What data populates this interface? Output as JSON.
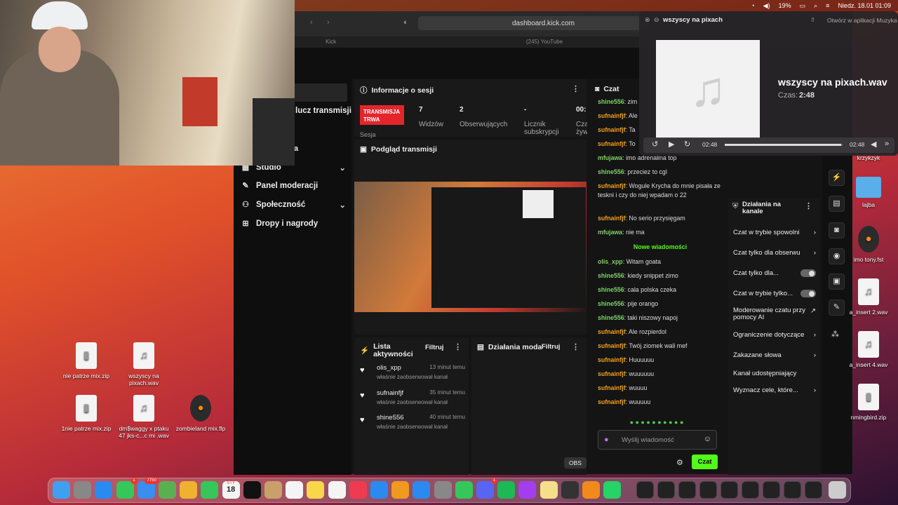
{
  "menubar": {
    "battery": "19%",
    "datetime": "Niedz. 18.01  01:09"
  },
  "browser": {
    "url": "dashboard.kick.com",
    "tab1": "Kick",
    "tab2": "(245) YouTube"
  },
  "leftnav": {
    "partial_label": "lucz transmisji",
    "partial_a": "a",
    "items": [
      {
        "label": "Studio",
        "icon": "studio-icon",
        "expand": true
      },
      {
        "label": "Panel moderacji",
        "icon": "wrench-icon",
        "expand": false
      },
      {
        "label": "Społeczność",
        "icon": "community-icon",
        "expand": true
      },
      {
        "label": "Dropy i nagrody",
        "icon": "gift-icon",
        "expand": false
      }
    ]
  },
  "session": {
    "title": "Informacje o sesji",
    "badge": "TRANSMISJA TRWA",
    "badge_sub": "Sesja",
    "stats": [
      {
        "value": "7",
        "label": "Widzów"
      },
      {
        "value": "2",
        "label": "Obserwujących"
      },
      {
        "value": "-",
        "label": "Licznik subskrypcji"
      },
      {
        "value": "00:",
        "label": "Cza żyw"
      }
    ]
  },
  "preview": {
    "title": "Podgląd transmisji"
  },
  "activity": {
    "title": "Lista aktywności",
    "filter": "Filtruj",
    "items": [
      {
        "user": "olis_xpp",
        "time": "13 minut temu",
        "action": "właśnie zaobserwował kanał"
      },
      {
        "user": "sufnainfjf",
        "time": "35 minut temu",
        "action": "właśnie zaobserwował kanał"
      },
      {
        "user": "shine556",
        "time": "40 minut temu",
        "action": "właśnie zaobserwował kanał"
      }
    ]
  },
  "modactions": {
    "title": "Działania moda",
    "filter": "Filtruj"
  },
  "chat": {
    "title": "Czat",
    "new_messages": "Nowe wiadomości",
    "placeholder": "Wyślij wiadomość",
    "send": "Czat",
    "messages": [
      {
        "user": "shine556",
        "text": "zim",
        "color": "green"
      },
      {
        "user": "sufnainfjf",
        "text": "Ale",
        "color": "orange"
      },
      {
        "user": "sufnainfjf",
        "text": "Ta",
        "color": "orange"
      },
      {
        "user": "sufnainfjf",
        "text": "To",
        "color": "orange"
      },
      {
        "user": "mfujawa",
        "text": "imo adrenalina top",
        "color": "green"
      },
      {
        "user": "shine556",
        "text": "przeciez to cgl",
        "color": "green"
      },
      {
        "user": "sufnainfjf",
        "text": "Wogule Krycha do mnie pisała ze teskni i czy do niej wpadam o 22",
        "color": "orange"
      },
      {
        "user": "sufnainfjf",
        "text": "No serio przysięgam",
        "color": "orange"
      },
      {
        "user": "mfujawa",
        "text": "nie ma",
        "color": "green"
      }
    ],
    "new": [
      {
        "user": "olis_xpp",
        "text": "Witam goata",
        "color": "green"
      },
      {
        "user": "shine556",
        "text": "kiedy snippet zimo",
        "color": "green"
      },
      {
        "user": "shine556",
        "text": "cala polska czeka",
        "color": "green"
      },
      {
        "user": "shine556",
        "text": "pije orango",
        "color": "green"
      },
      {
        "user": "shine556",
        "text": "taki niszowy napoj",
        "color": "green"
      },
      {
        "user": "sufnainfjf",
        "text": "Ale rozpierdol",
        "color": "orange"
      },
      {
        "user": "sufnainfjf",
        "text": "Twój ziomek wali mef",
        "color": "orange"
      },
      {
        "user": "sufnainfjf",
        "text": "Huuuuuu",
        "color": "orange"
      },
      {
        "user": "sufnainfjf",
        "text": "wuuuuuu",
        "color": "orange"
      },
      {
        "user": "sufnainfjf",
        "text": "wuuuu",
        "color": "orange"
      },
      {
        "user": "sufnainfjf",
        "text": "wuuuuu",
        "color": "orange"
      }
    ]
  },
  "channel_actions": {
    "title": "Działania na kanale",
    "rows": [
      {
        "label": "Czat w trybie spowolni",
        "ctrl": "chevron"
      },
      {
        "label": "Czat tylko dla obserwu",
        "ctrl": "chevron"
      },
      {
        "label": "Czat tylko dla...",
        "ctrl": "toggle"
      },
      {
        "label": "Czat w trybie tylko...",
        "ctrl": "toggle"
      },
      {
        "label": "Moderowanie czatu przy pomocy AI",
        "ctrl": "external"
      },
      {
        "label": "Ograniczenie dotyczące",
        "ctrl": "chevron"
      },
      {
        "label": "Zakazane słowa",
        "ctrl": "chevron"
      },
      {
        "label": "Kanał udostępniający",
        "ctrl": "none"
      },
      {
        "label": "Wyznacz cele, które...",
        "ctrl": "chevron"
      }
    ]
  },
  "player": {
    "header": "wszyscy na pixach",
    "open_in": "Otwórz w aplikacji Muzyka",
    "track": "wszyscy na pixach.wav",
    "time_label": "Czas:",
    "time": "2:48",
    "elapsed": "02:48",
    "total": "02:48",
    "progress": 0.99
  },
  "desktop": {
    "items": [
      {
        "label": "nie patrze mix.zip",
        "kind": "zip"
      },
      {
        "label": "wszyscy na pixach.wav",
        "kind": "audio"
      },
      {
        "label": "1nie patrze mix.zip",
        "kind": "zip"
      },
      {
        "label": "dm$waggy x ptaku 47 jks-c...c mi .wav",
        "kind": "audio"
      },
      {
        "label": "zombieland mix.flp",
        "kind": "flp"
      }
    ],
    "right": [
      {
        "label": "krzykzyk",
        "kind": "none"
      },
      {
        "label": "lajba",
        "kind": "folder"
      },
      {
        "label": "imo tony.fst",
        "kind": "flp"
      },
      {
        "label": "a_insert 2.wav",
        "kind": "audio"
      },
      {
        "label": "a_insert 4.wav",
        "kind": "audio"
      },
      {
        "label": "nmingbird.zip",
        "kind": "zip"
      }
    ]
  },
  "dock": {
    "obs_tooltip": "OBS",
    "badge_messages": "1",
    "badge_mail": "7750",
    "badge_discord": "1",
    "cal_month": "STY",
    "cal_day": "18"
  }
}
